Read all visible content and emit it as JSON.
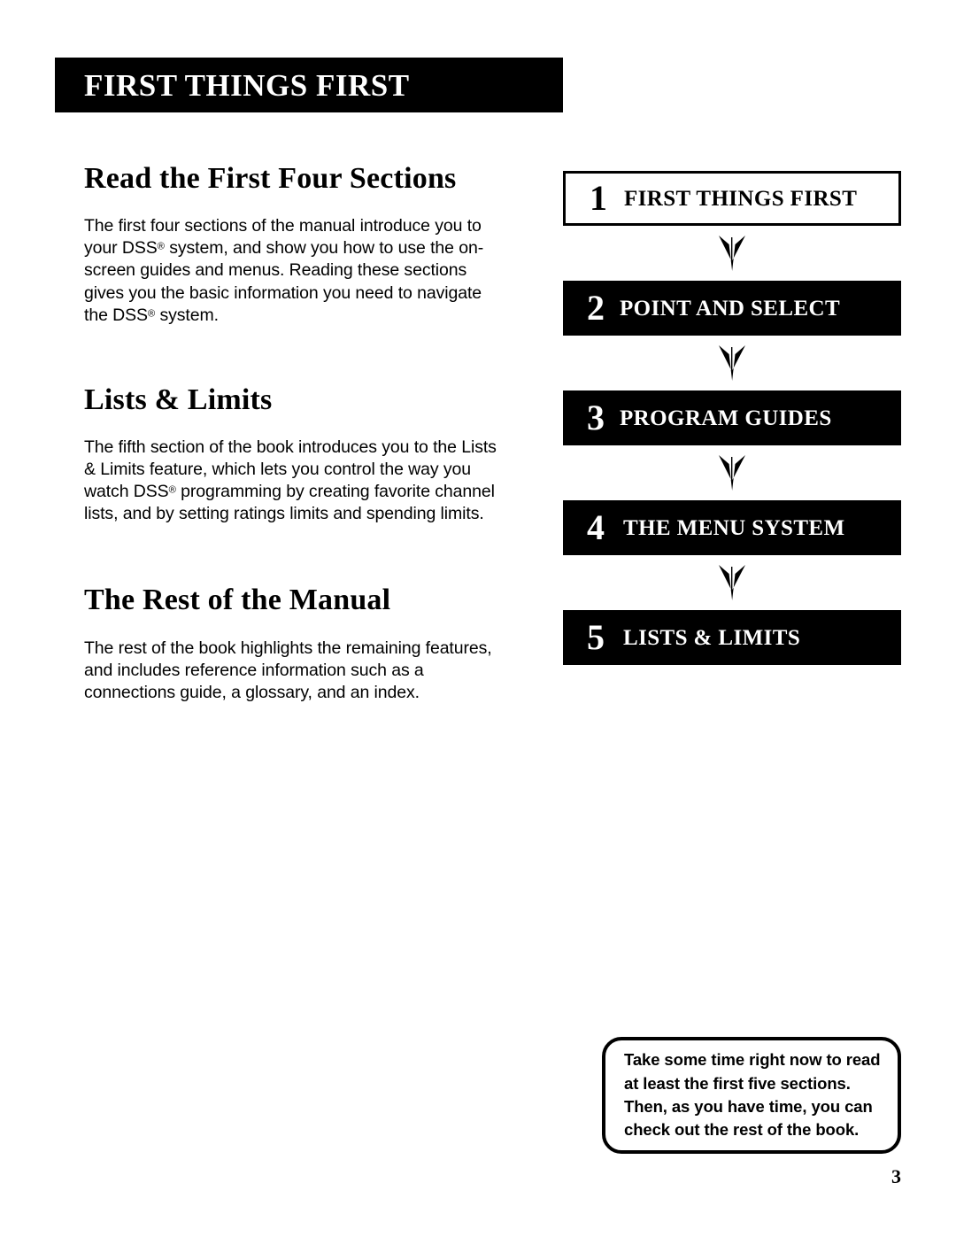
{
  "header": {
    "banner_title": "FIRST THINGS FIRST"
  },
  "sections": [
    {
      "heading": "Read the First Four Sections",
      "body_parts": [
        "The first four sections of the manual introduce you to your DSS",
        "®",
        " system, and show you how to use the on-screen guides and menus. Reading these sections gives you the basic information you need to navigate the DSS",
        "®",
        " system."
      ],
      "body_plain": "The first four sections of the manual introduce you to your DSS® system, and show you how to use the on-screen guides and menus. Reading these sections gives you the basic information you need to navigate the DSS® system."
    },
    {
      "heading": "Lists & Limits",
      "body_parts": [
        "The fifth section of the book introduces you to the Lists & Limits feature, which lets you control the way you watch DSS",
        "®",
        " programming by creating favorite channel lists, and by setting ratings limits and spending limits."
      ],
      "body_plain": "The fifth section of the book introduces you to the Lists & Limits feature, which lets you control the way you watch DSS® programming by creating favorite channel lists, and by setting ratings limits and spending limits."
    },
    {
      "heading": "The Rest of the Manual",
      "body_parts": [
        "The rest of the book highlights the remaining features, and includes reference information such as a connections guide, a glossary, and an index."
      ],
      "body_plain": "The rest of the book highlights the remaining features, and includes reference information such as a connections guide, a glossary, and an index."
    }
  ],
  "flowchart": {
    "arrow_icon": "down-chevron-arrow-icon",
    "steps": [
      {
        "number": "1",
        "label": "FIRST THINGS FIRST",
        "style": "outline"
      },
      {
        "number": "2",
        "label": "POINT AND SELECT",
        "style": "filled"
      },
      {
        "number": "3",
        "label": "PROGRAM GUIDES",
        "style": "filled"
      },
      {
        "number": "4",
        "label": "THE MENU SYSTEM",
        "style": "filled"
      },
      {
        "number": "5",
        "label": "LISTS & LIMITS",
        "style": "filled"
      }
    ]
  },
  "callout": {
    "lines": [
      "Take some time right now to read",
      "at least the first five sections.",
      "Then, as you have time, you can",
      "check out the rest of the book."
    ]
  },
  "footer": {
    "page_number": "3"
  },
  "colors": {
    "ink": "#000000",
    "paper": "#ffffff"
  }
}
